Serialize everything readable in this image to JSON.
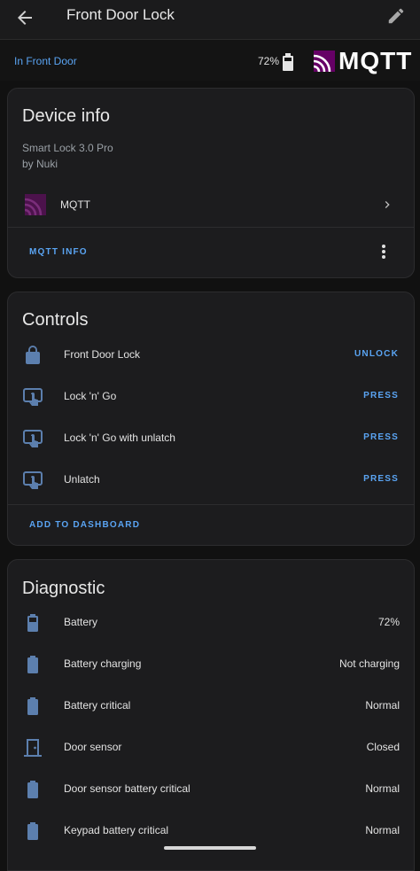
{
  "header": {
    "title": "Front Door Lock"
  },
  "subheader": {
    "area": "In Front Door",
    "battery": "72%",
    "brand": "MQTT"
  },
  "device_info": {
    "title": "Device info",
    "model": "Smart Lock 3.0 Pro",
    "manufacturer": "by Nuki",
    "integration": "MQTT",
    "action": "MQTT INFO"
  },
  "controls": {
    "title": "Controls",
    "items": [
      {
        "label": "Front Door Lock",
        "action": "UNLOCK",
        "icon": "lock-icon"
      },
      {
        "label": "Lock 'n' Go",
        "action": "PRESS",
        "icon": "gesture-tap-icon"
      },
      {
        "label": "Lock 'n' Go with unlatch",
        "action": "PRESS",
        "icon": "gesture-tap-icon"
      },
      {
        "label": "Unlatch",
        "action": "PRESS",
        "icon": "gesture-tap-icon"
      }
    ],
    "add": "ADD TO DASHBOARD"
  },
  "diagnostic": {
    "title": "Diagnostic",
    "items": [
      {
        "label": "Battery",
        "value": "72%",
        "icon": "battery-icon"
      },
      {
        "label": "Battery charging",
        "value": "Not charging",
        "icon": "battery-icon"
      },
      {
        "label": "Battery critical",
        "value": "Normal",
        "icon": "battery-icon"
      },
      {
        "label": "Door sensor",
        "value": "Closed",
        "icon": "door-icon"
      },
      {
        "label": "Door sensor battery critical",
        "value": "Normal",
        "icon": "battery-icon"
      },
      {
        "label": "Keypad battery critical",
        "value": "Normal",
        "icon": "battery-icon"
      }
    ]
  },
  "colors": {
    "accent": "#5aa4f3",
    "icon": "#5c7fae",
    "mqtt_purple": "#660066"
  }
}
